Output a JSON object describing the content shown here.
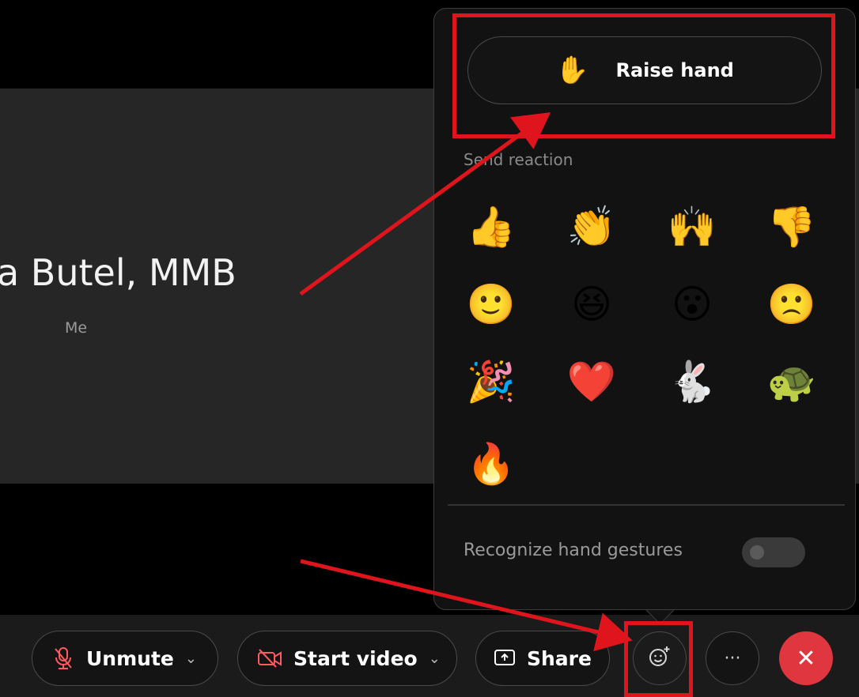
{
  "participant": {
    "name": "a Butel, MMB",
    "sub": "Me"
  },
  "popover": {
    "raise_hand_label": "Raise hand",
    "send_reaction_label": "Send reaction",
    "reactions": [
      {
        "name": "thumbs-up",
        "glyph": "👍"
      },
      {
        "name": "clapping",
        "glyph": "👏"
      },
      {
        "name": "celebrate",
        "glyph": "🙌"
      },
      {
        "name": "thumbs-down",
        "glyph": "👎"
      },
      {
        "name": "smile",
        "glyph": "🙂"
      },
      {
        "name": "laugh",
        "glyph": "😆"
      },
      {
        "name": "surprised",
        "glyph": "😮"
      },
      {
        "name": "sad",
        "glyph": "🙁"
      },
      {
        "name": "party",
        "glyph": "🎉"
      },
      {
        "name": "heart",
        "glyph": "❤️"
      },
      {
        "name": "rabbit",
        "glyph": "🐇"
      },
      {
        "name": "turtle",
        "glyph": "🐢"
      },
      {
        "name": "fire",
        "glyph": "🔥"
      }
    ],
    "gesture_label": "Recognize hand gestures",
    "gesture_enabled": false,
    "hand_glyph": "✋"
  },
  "toolbar": {
    "unmute_label": "Unmute",
    "start_video_label": "Start video",
    "share_label": "Share",
    "more_label": "···",
    "leave_glyph": "✕",
    "chevron_glyph": "⌄"
  },
  "colors": {
    "accent_red": "#e0363f",
    "annotation_red": "#e0141c"
  }
}
